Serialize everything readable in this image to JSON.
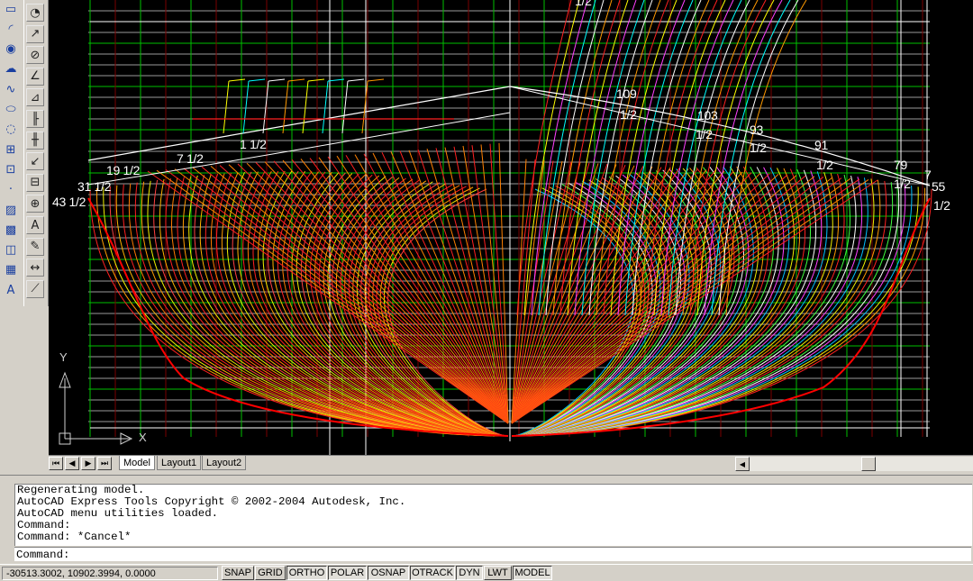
{
  "toolbar_left": {
    "items": [
      {
        "name": "rectangle-icon",
        "glyph": "▭"
      },
      {
        "name": "arc-icon",
        "glyph": "◜"
      },
      {
        "name": "circle-icon",
        "glyph": "◉"
      },
      {
        "name": "revision-cloud-icon",
        "glyph": "☁"
      },
      {
        "name": "spline-icon",
        "glyph": "∿"
      },
      {
        "name": "ellipse-icon",
        "glyph": "⬭"
      },
      {
        "name": "ellipse-arc-icon",
        "glyph": "◌"
      },
      {
        "name": "insert-block-icon",
        "glyph": "⊞"
      },
      {
        "name": "make-block-icon",
        "glyph": "⊡"
      },
      {
        "name": "point-icon",
        "glyph": "·"
      },
      {
        "name": "hatch-icon",
        "glyph": "▨"
      },
      {
        "name": "gradient-icon",
        "glyph": "▩"
      },
      {
        "name": "region-icon",
        "glyph": "◫"
      },
      {
        "name": "table-icon",
        "glyph": "▦"
      },
      {
        "name": "multiline-text-icon",
        "glyph": "A"
      }
    ]
  },
  "toolbar_dim": {
    "items": [
      {
        "name": "dim-radius-icon",
        "glyph": "◔"
      },
      {
        "name": "dim-jogged-icon",
        "glyph": "↗"
      },
      {
        "name": "dim-diameter-icon",
        "glyph": "⊘"
      },
      {
        "name": "dim-angular-icon",
        "glyph": "∠"
      },
      {
        "name": "quick-dim-icon",
        "glyph": "⊿"
      },
      {
        "name": "dim-baseline-icon",
        "glyph": "╟"
      },
      {
        "name": "dim-continue-icon",
        "glyph": "╫"
      },
      {
        "name": "quick-leader-icon",
        "glyph": "↙"
      },
      {
        "name": "tolerance-icon",
        "glyph": "⊟"
      },
      {
        "name": "center-mark-icon",
        "glyph": "⊕"
      },
      {
        "name": "dim-edit-icon",
        "glyph": "A"
      },
      {
        "name": "dim-text-edit-icon",
        "glyph": "✎"
      },
      {
        "name": "dim-update-icon",
        "glyph": "↔"
      },
      {
        "name": "dim-style-icon",
        "glyph": "⟋"
      }
    ]
  },
  "drawing": {
    "labels": [
      "1/2",
      "109",
      "1/2",
      "103",
      "1/2",
      "93",
      "1/2",
      "91",
      "1/2",
      "79",
      "1/2",
      "55",
      "1/2",
      "1 1/2",
      "7 1/2",
      "19 1/2",
      "31 1/2",
      "43 1/2",
      "7"
    ],
    "ucs_x": "X",
    "ucs_y": "Y",
    "colors": {
      "background": "#000000",
      "grid_green": "#00c000",
      "grid_white": "#c8c8c8",
      "hull_red": "#ff2020",
      "hull_orange": "#ff9a00",
      "hull_yellow": "#f0f000"
    }
  },
  "tabs": {
    "nav_first": "⏮",
    "nav_prev": "◀",
    "nav_next": "▶",
    "nav_last": "⏭",
    "items": [
      "Model",
      "Layout1",
      "Layout2"
    ]
  },
  "command": {
    "history": [
      "Regenerating model.",
      "AutoCAD Express Tools Copyright © 2002-2004 Autodesk, Inc.",
      "AutoCAD menu utilities loaded.",
      "Command:",
      "Command: *Cancel*"
    ],
    "prompt": "Command:"
  },
  "status": {
    "coordinates": "-30513.3002, 10902.3994, 0.0000",
    "buttons": [
      "SNAP",
      "GRID",
      "ORTHO",
      "POLAR",
      "OSNAP",
      "OTRACK",
      "DYN",
      "LWT",
      "MODEL"
    ]
  }
}
